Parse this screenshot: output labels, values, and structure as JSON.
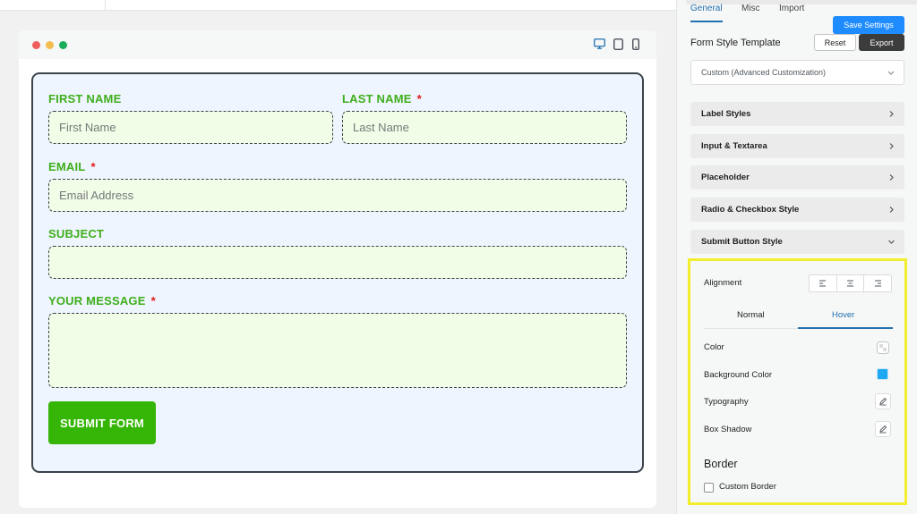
{
  "settings_tabs": [
    "General",
    "Misc",
    "Import"
  ],
  "save_button": "Save Settings",
  "template": {
    "title": "Form Style Template",
    "reset": "Reset",
    "export": "Export",
    "selected": "Custom (Advanced Customization)"
  },
  "accordion": [
    "Label Styles",
    "Input & Textarea",
    "Placeholder",
    "Radio & Checkbox Style",
    "Submit Button Style"
  ],
  "submit_style": {
    "alignment_label": "Alignment",
    "tabs": [
      "Normal",
      "Hover"
    ],
    "active_tab": "Hover",
    "color_label": "Color",
    "background_color_label": "Background Color",
    "background_color_value": "#1ea7f2",
    "typography_label": "Typography",
    "box_shadow_label": "Box Shadow",
    "border_heading": "Border",
    "custom_border_label": "Custom Border"
  },
  "preview_devices": [
    "desktop-icon",
    "tablet-icon",
    "mobile-icon"
  ],
  "form": {
    "first_name": {
      "label": "FIRST NAME",
      "placeholder": "First Name"
    },
    "last_name": {
      "label": "LAST NAME",
      "required": "*",
      "placeholder": "Last Name"
    },
    "email": {
      "label": "EMAIL",
      "required": "*",
      "placeholder": "Email Address"
    },
    "subject": {
      "label": "SUBJECT",
      "placeholder": ""
    },
    "message": {
      "label": "YOUR MESSAGE",
      "required": "*",
      "placeholder": ""
    },
    "submit": "SUBMIT FORM"
  },
  "colors": {
    "label_color": "#3fae1b",
    "input_bg": "#f1fde7",
    "form_bg": "#eef5fe",
    "submit_bg": "#35b606",
    "primary_blue": "#1e8cff",
    "highlight": "#f2ee2c"
  }
}
